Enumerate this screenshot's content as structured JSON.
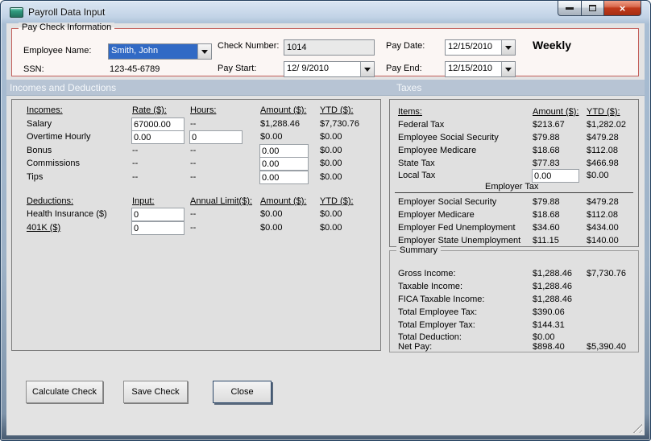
{
  "window": {
    "title": "Payroll Data Input",
    "close_glyph": "×"
  },
  "colors": {
    "selection_blue": "#316ac5",
    "section_band": "#b7c4d4",
    "group_border_red": "#c35f5a",
    "close_button_red": "#c03a1c",
    "client_bg": "#e3e3e3"
  },
  "paycheck_info": {
    "legend": "Pay Check Information",
    "employee_name_label": "Employee Name:",
    "employee_name_value": "Smith, John",
    "ssn_label": "SSN:",
    "ssn_value": "123-45-6789",
    "check_number_label": "Check Number:",
    "check_number_value": "1014",
    "pay_start_label": "Pay Start:",
    "pay_start_value": "12/ 9/2010",
    "pay_date_label": "Pay Date:",
    "pay_date_value": "12/15/2010",
    "pay_end_label": "Pay End:",
    "pay_end_value": "12/15/2010",
    "frequency": "Weekly"
  },
  "sections": {
    "incomes_deductions": "Incomes and Deductions",
    "taxes": "Taxes"
  },
  "incomes": {
    "headers": {
      "item": "Incomes:",
      "rate": "Rate ($):",
      "hours": "Hours:",
      "amount": "Amount ($):",
      "ytd": "YTD ($):"
    },
    "rows": [
      {
        "label": "Salary",
        "rate": "67000.00",
        "hours": "--",
        "amount": "$1,288.46",
        "ytd": "$7,730.76"
      },
      {
        "label": "Overtime Hourly",
        "rate": "0.00",
        "hours": "0",
        "amount": "$0.00",
        "ytd": "$0.00"
      },
      {
        "label": "Bonus",
        "rate": "--",
        "hours": "--",
        "amount": "0.00",
        "ytd": "$0.00"
      },
      {
        "label": "Commissions",
        "rate": "--",
        "hours": "--",
        "amount": "0.00",
        "ytd": "$0.00"
      },
      {
        "label": "Tips",
        "rate": "--",
        "hours": "--",
        "amount": "0.00",
        "ytd": "$0.00"
      }
    ]
  },
  "deductions": {
    "headers": {
      "item": "Deductions:",
      "input": "Input:",
      "annual_limit": "Annual Limit($):",
      "amount": "Amount ($):",
      "ytd": "YTD ($):"
    },
    "rows": [
      {
        "label": "Health Insurance  ($)",
        "input": "0",
        "annual_limit": "--",
        "amount": "$0.00",
        "ytd": "$0.00"
      },
      {
        "label": "401K  ($)",
        "input": "0",
        "annual_limit": "--",
        "amount": "$0.00",
        "ytd": "$0.00"
      }
    ]
  },
  "taxes": {
    "headers": {
      "item": "Items:",
      "amount": "Amount ($):",
      "ytd": "YTD ($):"
    },
    "employee_rows": [
      {
        "label": "Federal Tax",
        "amount": "$213.67",
        "ytd": "$1,282.02"
      },
      {
        "label": "Employee Social Security",
        "amount": "$79.88",
        "ytd": "$479.28"
      },
      {
        "label": "Employee Medicare",
        "amount": "$18.68",
        "ytd": "$112.08"
      },
      {
        "label": "State Tax",
        "amount": "$77.83",
        "ytd": "$466.98"
      },
      {
        "label": "Local Tax",
        "amount": "0.00",
        "ytd": "$0.00"
      }
    ],
    "employer_header": "Employer Tax",
    "employer_rows": [
      {
        "label": "Employer Social Security",
        "amount": "$79.88",
        "ytd": "$479.28"
      },
      {
        "label": "Employer Medicare",
        "amount": "$18.68",
        "ytd": "$112.08"
      },
      {
        "label": "Employer Fed Unemployment",
        "amount": "$34.60",
        "ytd": "$434.00"
      },
      {
        "label": "Employer State Unemployment",
        "amount": "$11.15",
        "ytd": "$140.00"
      }
    ]
  },
  "summary": {
    "legend": "Summary",
    "rows": [
      {
        "label": "Gross Income:",
        "amount": "$1,288.46",
        "ytd": "$7,730.76"
      },
      {
        "label": "Taxable Income:",
        "amount": "$1,288.46",
        "ytd": ""
      },
      {
        "label": "FICA Taxable Income:",
        "amount": "$1,288.46",
        "ytd": ""
      },
      {
        "label": "Total Employee Tax:",
        "amount": "$390.06",
        "ytd": ""
      },
      {
        "label": "Total Employer Tax:",
        "amount": "$144.31",
        "ytd": ""
      },
      {
        "label": "Total Deduction:",
        "amount": "$0.00",
        "ytd": ""
      },
      {
        "label": "Net Pay:",
        "amount": "$898.40",
        "ytd": "$5,390.40"
      }
    ]
  },
  "buttons": {
    "calculate": "Calculate Check",
    "save": "Save Check",
    "close": "Close"
  }
}
